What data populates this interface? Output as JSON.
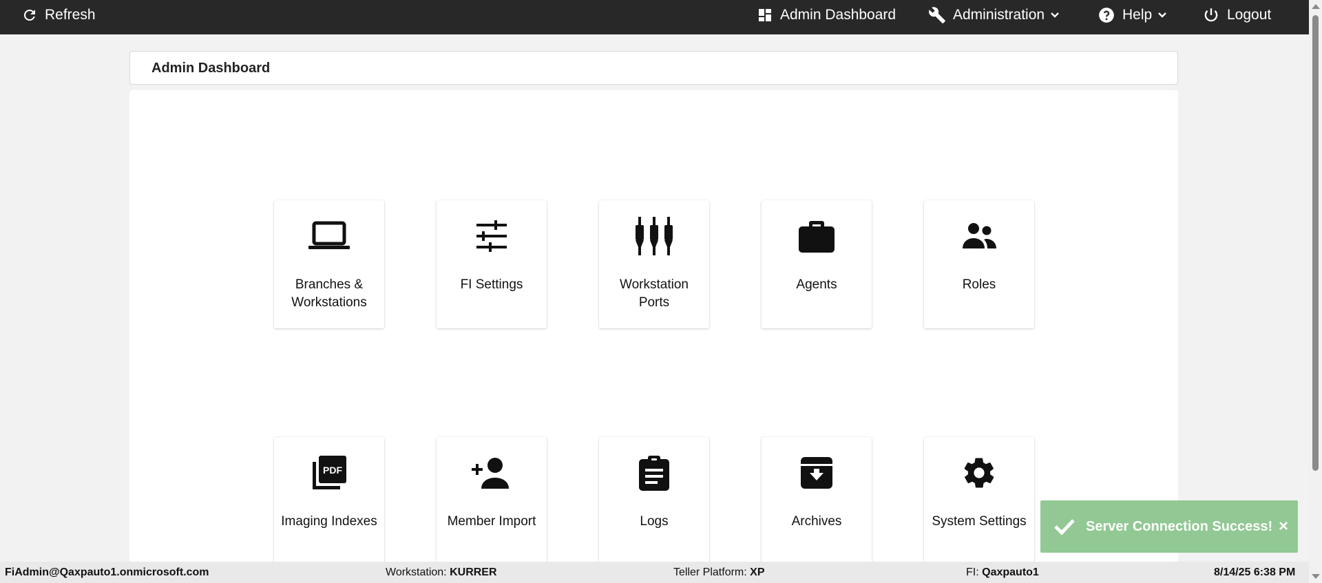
{
  "navbar": {
    "refresh_label": "Refresh",
    "dashboard_label": "Admin Dashboard",
    "administration_label": "Administration",
    "help_label": "Help",
    "logout_label": "Logout"
  },
  "page": {
    "title": "Admin Dashboard"
  },
  "tiles": [
    {
      "label": "Branches & Workstations",
      "icon": "laptop-icon"
    },
    {
      "label": "FI Settings",
      "icon": "sliders-icon"
    },
    {
      "label": "Workstation Ports",
      "icon": "ports-icon"
    },
    {
      "label": "Agents",
      "icon": "briefcase-icon"
    },
    {
      "label": "Roles",
      "icon": "people-icon"
    },
    {
      "label": "Imaging Indexes",
      "icon": "pdf-icon"
    },
    {
      "label": "Member Import",
      "icon": "add-person-icon"
    },
    {
      "label": "Logs",
      "icon": "clipboard-icon"
    },
    {
      "label": "Archives",
      "icon": "archive-icon"
    },
    {
      "label": "System Settings",
      "icon": "gear-icon"
    }
  ],
  "toast": {
    "message": "Server Connection Success!",
    "close": "×",
    "color": "#8cc68e"
  },
  "status": {
    "user": "FiAdmin@Qaxpauto1.onmicrosoft.com",
    "workstation_label": "Workstation:",
    "workstation_value": "KURRER",
    "platform_label": "Teller Platform:",
    "platform_value": "XP",
    "fi_label": "FI:",
    "fi_value": "Qaxpauto1",
    "datetime": "8/14/25 6:38 PM"
  },
  "colors": {
    "navbar": "#282828",
    "background": "#f2f2f2"
  }
}
